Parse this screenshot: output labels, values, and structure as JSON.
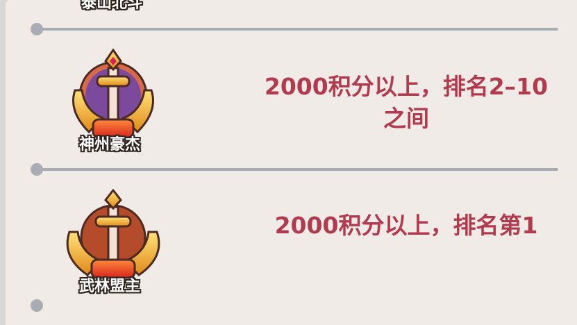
{
  "ranks": [
    {
      "name": "泰山北斗",
      "requirement": ""
    },
    {
      "name": "神州豪杰",
      "requirement": "2000积分以上，排名2–10之间"
    },
    {
      "name": "武林盟主",
      "requirement": "2000积分以上，排名第1"
    }
  ],
  "colors": {
    "panel_bg": "#f0ebe6",
    "divider": "#a9adb3",
    "requirement_text": "#b23a4e"
  },
  "icons": [
    "sword-wings-badge-icon",
    "sword-wings-badge-icon"
  ]
}
